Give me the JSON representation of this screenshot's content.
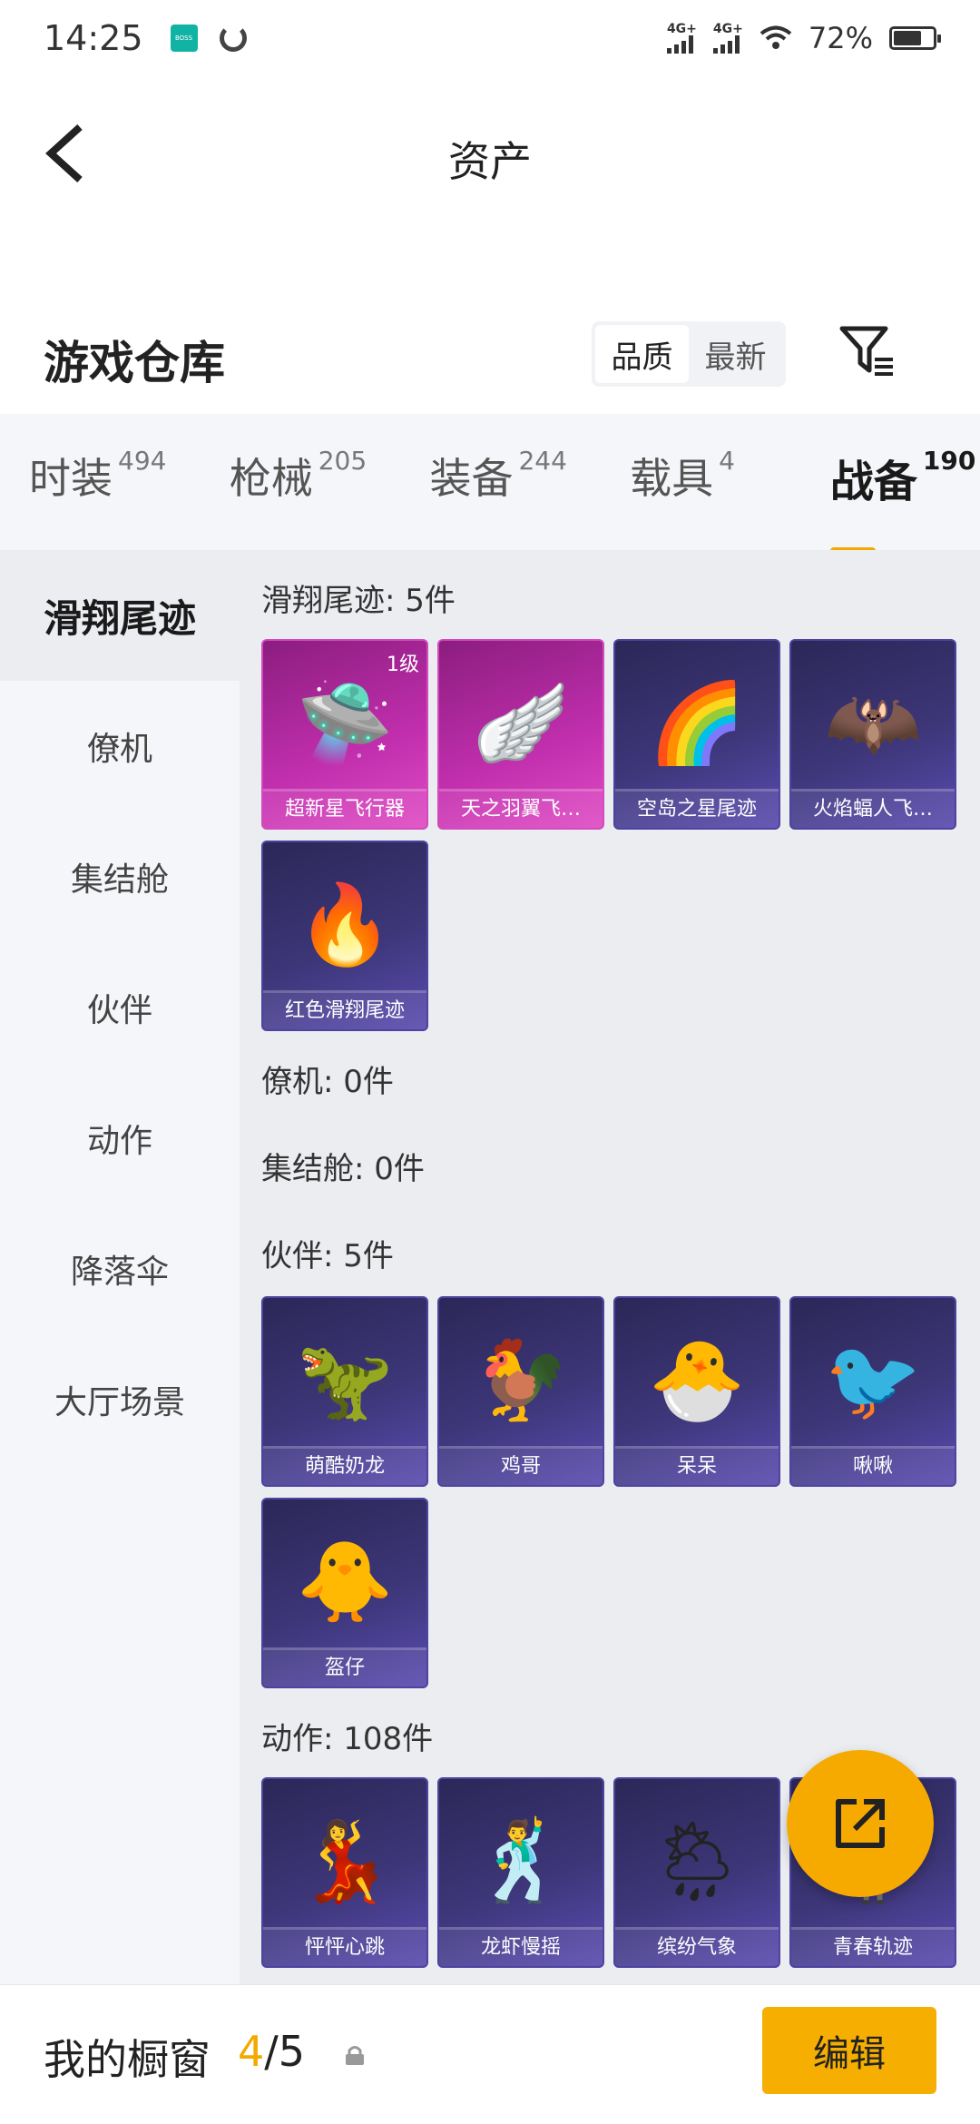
{
  "status_bar": {
    "time": "14:25",
    "app_badge": "BOSS直聘",
    "network_1": "4G+",
    "network_2": "4G+",
    "battery": "72%",
    "battery_level": 0.72
  },
  "header": {
    "title": "资产",
    "back_icon": "chevron-left-icon"
  },
  "warehouse": {
    "title": "游戏仓库",
    "sort_options": [
      "品质",
      "最新"
    ],
    "sort_selected": "品质",
    "filter_icon": "filter-icon"
  },
  "tabs": [
    {
      "label": "时装",
      "count": "494"
    },
    {
      "label": "枪械",
      "count": "205"
    },
    {
      "label": "装备",
      "count": "244"
    },
    {
      "label": "载具",
      "count": "4"
    },
    {
      "label": "战备",
      "count": "190"
    }
  ],
  "active_tab": "战备",
  "sidenav": [
    "滑翔尾迹",
    "僚机",
    "集结舱",
    "伙伴",
    "动作",
    "降落伞",
    "大厅场景"
  ],
  "active_sidenav": "滑翔尾迹",
  "sections": {
    "glide": {
      "title": "滑翔尾迹: 5件",
      "items": [
        {
          "name": "超新星飞行器",
          "level": "1级"
        },
        {
          "name": "天之羽翼飞…"
        },
        {
          "name": "空岛之星尾迹"
        },
        {
          "name": "火焰蝠人飞…"
        },
        {
          "name": "红色滑翔尾迹"
        }
      ]
    },
    "wingman": {
      "title": "僚机: 0件"
    },
    "pod": {
      "title": "集结舱: 0件"
    },
    "partner": {
      "title": "伙伴: 5件",
      "items": [
        {
          "name": "萌酷奶龙"
        },
        {
          "name": "鸡哥"
        },
        {
          "name": "呆呆"
        },
        {
          "name": "啾啾"
        },
        {
          "name": "盔仔"
        }
      ]
    },
    "action": {
      "title": "动作: 108件",
      "items": [
        {
          "name": "怦怦心跳"
        },
        {
          "name": "龙虾慢摇"
        },
        {
          "name": "缤纷气象"
        },
        {
          "name": "青春轨迹"
        }
      ]
    }
  },
  "fab_icon": "share-out-icon",
  "bottom": {
    "label": "我的橱窗",
    "current": "4",
    "slash": "/",
    "total": "5",
    "lock_icon": "lock-icon",
    "edit": "编辑"
  },
  "colors": {
    "accent": "#f6ae00",
    "item_purple": "#3d3678",
    "item_pink": "#c22fae"
  }
}
